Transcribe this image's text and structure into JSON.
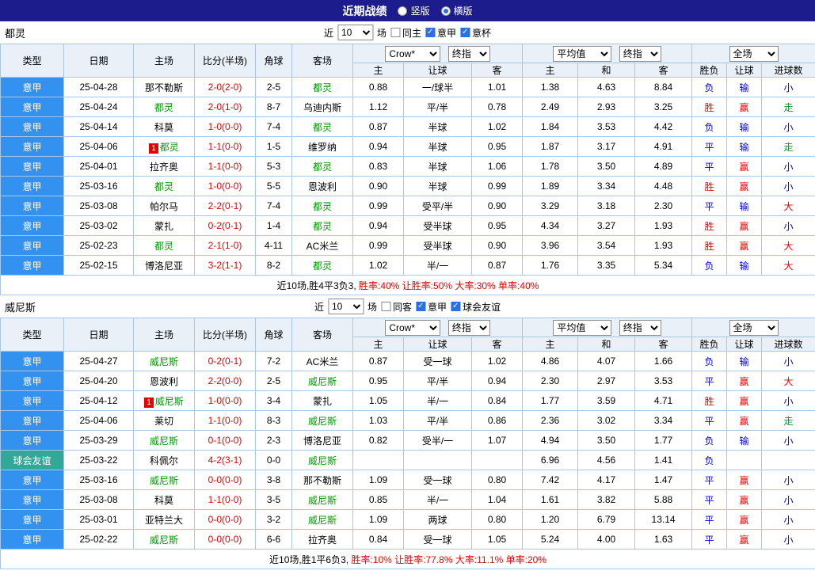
{
  "top_bar": {
    "title": "近期战绩",
    "layout_options": [
      {
        "label": "竖版",
        "selected": false
      },
      {
        "label": "横版",
        "selected": true
      }
    ]
  },
  "controls": {
    "near": "近",
    "count": "10",
    "games": "场",
    "book": "Crow*",
    "index": "终指",
    "avg": "平均值",
    "scope": "全场"
  },
  "columns": {
    "type": "类型",
    "date": "日期",
    "home": "主场",
    "score": "比分(半场)",
    "corner": "角球",
    "away": "客场",
    "odds_home": "主",
    "odds_line": "让球",
    "odds_away": "客",
    "avg_home": "主",
    "avg_draw": "和",
    "avg_away": "客",
    "res_outcome": "胜负",
    "res_handicap": "让球",
    "res_goals": "进球数"
  },
  "colors": {
    "topbar_bg": "#1c1c8c",
    "league_bg": "#3391f0",
    "friendly_bg": "#31a898",
    "focal_team": "#009900",
    "win_text": "#e60000",
    "lose_text": "#0000e0",
    "push_text": "#009933",
    "score_text": "#e60000"
  },
  "sections": [
    {
      "name": "都灵",
      "checks": [
        {
          "label": "同主",
          "on": false
        },
        {
          "label": "意甲",
          "on": true
        },
        {
          "label": "意杯",
          "on": true
        }
      ],
      "rows": [
        {
          "lg": "意甲",
          "lgc": "league",
          "date": "25-04-28",
          "badge": "",
          "home": "那不勒斯",
          "homec": "",
          "score": "2-0(2-0)",
          "corner": "2-5",
          "away": "都灵",
          "awayc": "focal",
          "o1": "0.88",
          "line": "一/球半",
          "o2": "1.01",
          "m1": "1.38",
          "m2": "4.63",
          "m3": "8.84",
          "r1": "负",
          "r1c": "blue",
          "r2": "输",
          "r2c": "blue",
          "r3": "小",
          "r3c": "blue"
        },
        {
          "lg": "意甲",
          "lgc": "league",
          "date": "25-04-24",
          "badge": "",
          "home": "都灵",
          "homec": "focal",
          "score": "2-0(1-0)",
          "corner": "8-7",
          "away": "乌迪内斯",
          "awayc": "",
          "o1": "1.12",
          "line": "平/半",
          "o2": "0.78",
          "m1": "2.49",
          "m2": "2.93",
          "m3": "3.25",
          "r1": "胜",
          "r1c": "red",
          "r2": "赢",
          "r2c": "red",
          "r3": "走",
          "r3c": "green"
        },
        {
          "lg": "意甲",
          "lgc": "league",
          "date": "25-04-14",
          "badge": "",
          "home": "科莫",
          "homec": "",
          "score": "1-0(0-0)",
          "corner": "7-4",
          "away": "都灵",
          "awayc": "focal",
          "o1": "0.87",
          "line": "半球",
          "o2": "1.02",
          "m1": "1.84",
          "m2": "3.53",
          "m3": "4.42",
          "r1": "负",
          "r1c": "blue",
          "r2": "输",
          "r2c": "blue",
          "r3": "小",
          "r3c": "blue"
        },
        {
          "lg": "意甲",
          "lgc": "league",
          "date": "25-04-06",
          "badge": "1",
          "home": "都灵",
          "homec": "focal",
          "score": "1-1(0-0)",
          "corner": "1-5",
          "away": "维罗纳",
          "awayc": "",
          "o1": "0.94",
          "line": "半球",
          "o2": "0.95",
          "m1": "1.87",
          "m2": "3.17",
          "m3": "4.91",
          "r1": "平",
          "r1c": "blue",
          "r2": "输",
          "r2c": "blue",
          "r3": "走",
          "r3c": "green"
        },
        {
          "lg": "意甲",
          "lgc": "league",
          "date": "25-04-01",
          "badge": "",
          "home": "拉齐奥",
          "homec": "",
          "score": "1-1(0-0)",
          "corner": "5-3",
          "away": "都灵",
          "awayc": "focal",
          "o1": "0.83",
          "line": "半球",
          "o2": "1.06",
          "m1": "1.78",
          "m2": "3.50",
          "m3": "4.89",
          "r1": "平",
          "r1c": "blue",
          "r2": "赢",
          "r2c": "red",
          "r3": "小",
          "r3c": "blue"
        },
        {
          "lg": "意甲",
          "lgc": "league",
          "date": "25-03-16",
          "badge": "",
          "home": "都灵",
          "homec": "focal",
          "score": "1-0(0-0)",
          "corner": "5-5",
          "away": "恩波利",
          "awayc": "",
          "o1": "0.90",
          "line": "半球",
          "o2": "0.99",
          "m1": "1.89",
          "m2": "3.34",
          "m3": "4.48",
          "r1": "胜",
          "r1c": "red",
          "r2": "赢",
          "r2c": "red",
          "r3": "小",
          "r3c": "blue"
        },
        {
          "lg": "意甲",
          "lgc": "league",
          "date": "25-03-08",
          "badge": "",
          "home": "帕尔马",
          "homec": "",
          "score": "2-2(0-1)",
          "corner": "7-4",
          "away": "都灵",
          "awayc": "focal",
          "o1": "0.99",
          "line": "受平/半",
          "o2": "0.90",
          "m1": "3.29",
          "m2": "3.18",
          "m3": "2.30",
          "r1": "平",
          "r1c": "blue",
          "r2": "输",
          "r2c": "blue",
          "r3": "大",
          "r3c": "red"
        },
        {
          "lg": "意甲",
          "lgc": "league",
          "date": "25-03-02",
          "badge": "",
          "home": "蒙扎",
          "homec": "",
          "score": "0-2(0-1)",
          "corner": "1-4",
          "away": "都灵",
          "awayc": "focal",
          "o1": "0.94",
          "line": "受半球",
          "o2": "0.95",
          "m1": "4.34",
          "m2": "3.27",
          "m3": "1.93",
          "r1": "胜",
          "r1c": "red",
          "r2": "赢",
          "r2c": "red",
          "r3": "小",
          "r3c": "blue"
        },
        {
          "lg": "意甲",
          "lgc": "league",
          "date": "25-02-23",
          "badge": "",
          "home": "都灵",
          "homec": "focal",
          "score": "2-1(1-0)",
          "corner": "4-11",
          "away": "AC米兰",
          "awayc": "",
          "o1": "0.99",
          "line": "受半球",
          "o2": "0.90",
          "m1": "3.96",
          "m2": "3.54",
          "m3": "1.93",
          "r1": "胜",
          "r1c": "red",
          "r2": "赢",
          "r2c": "red",
          "r3": "大",
          "r3c": "red"
        },
        {
          "lg": "意甲",
          "lgc": "league",
          "date": "25-02-15",
          "badge": "",
          "home": "博洛尼亚",
          "homec": "",
          "score": "3-2(1-1)",
          "corner": "8-2",
          "away": "都灵",
          "awayc": "focal",
          "o1": "1.02",
          "line": "半/一",
          "o2": "0.87",
          "m1": "1.76",
          "m2": "3.35",
          "m3": "5.34",
          "r1": "负",
          "r1c": "blue",
          "r2": "输",
          "r2c": "blue",
          "r3": "大",
          "r3c": "red"
        }
      ],
      "footer": {
        "summary": "近10场,胜4平3负3,",
        "stats": "胜率:40% 让胜率:50% 大率:30% 单率:40%"
      }
    },
    {
      "name": "威尼斯",
      "checks": [
        {
          "label": "同客",
          "on": false
        },
        {
          "label": "意甲",
          "on": true
        },
        {
          "label": "球会友谊",
          "on": true
        }
      ],
      "rows": [
        {
          "lg": "意甲",
          "lgc": "league",
          "date": "25-04-27",
          "badge": "",
          "home": "威尼斯",
          "homec": "focal",
          "score": "0-2(0-1)",
          "corner": "7-2",
          "away": "AC米兰",
          "awayc": "",
          "o1": "0.87",
          "line": "受一球",
          "o2": "1.02",
          "m1": "4.86",
          "m2": "4.07",
          "m3": "1.66",
          "r1": "负",
          "r1c": "blue",
          "r2": "输",
          "r2c": "blue",
          "r3": "小",
          "r3c": "blue"
        },
        {
          "lg": "意甲",
          "lgc": "league",
          "date": "25-04-20",
          "badge": "",
          "home": "恩波利",
          "homec": "",
          "score": "2-2(0-0)",
          "corner": "2-5",
          "away": "威尼斯",
          "awayc": "focal",
          "o1": "0.95",
          "line": "平/半",
          "o2": "0.94",
          "m1": "2.30",
          "m2": "2.97",
          "m3": "3.53",
          "r1": "平",
          "r1c": "blue",
          "r2": "赢",
          "r2c": "red",
          "r3": "大",
          "r3c": "red"
        },
        {
          "lg": "意甲",
          "lgc": "league",
          "date": "25-04-12",
          "badge": "1",
          "home": "威尼斯",
          "homec": "focal",
          "score": "1-0(0-0)",
          "corner": "3-4",
          "away": "蒙扎",
          "awayc": "",
          "o1": "1.05",
          "line": "半/一",
          "o2": "0.84",
          "m1": "1.77",
          "m2": "3.59",
          "m3": "4.71",
          "r1": "胜",
          "r1c": "red",
          "r2": "赢",
          "r2c": "red",
          "r3": "小",
          "r3c": "blue"
        },
        {
          "lg": "意甲",
          "lgc": "league",
          "date": "25-04-06",
          "badge": "",
          "home": "莱切",
          "homec": "",
          "score": "1-1(0-0)",
          "corner": "8-3",
          "away": "威尼斯",
          "awayc": "focal",
          "o1": "1.03",
          "line": "平/半",
          "o2": "0.86",
          "m1": "2.36",
          "m2": "3.02",
          "m3": "3.34",
          "r1": "平",
          "r1c": "blue",
          "r2": "赢",
          "r2c": "red",
          "r3": "走",
          "r3c": "green"
        },
        {
          "lg": "意甲",
          "lgc": "league",
          "date": "25-03-29",
          "badge": "",
          "home": "威尼斯",
          "homec": "focal",
          "score": "0-1(0-0)",
          "corner": "2-3",
          "away": "博洛尼亚",
          "awayc": "",
          "o1": "0.82",
          "line": "受半/一",
          "o2": "1.07",
          "m1": "4.94",
          "m2": "3.50",
          "m3": "1.77",
          "r1": "负",
          "r1c": "blue",
          "r2": "输",
          "r2c": "blue",
          "r3": "小",
          "r3c": "blue"
        },
        {
          "lg": "球会友谊",
          "lgc": "friendly",
          "date": "25-03-22",
          "badge": "",
          "home": "科佩尔",
          "homec": "",
          "score": "4-2(3-1)",
          "corner": "0-0",
          "away": "威尼斯",
          "awayc": "focal",
          "o1": "",
          "line": "",
          "o2": "",
          "m1": "6.96",
          "m2": "4.56",
          "m3": "1.41",
          "r1": "负",
          "r1c": "blue",
          "r2": "",
          "r2c": "",
          "r3": "",
          "r3c": ""
        },
        {
          "lg": "意甲",
          "lgc": "league",
          "date": "25-03-16",
          "badge": "",
          "home": "威尼斯",
          "homec": "focal",
          "score": "0-0(0-0)",
          "corner": "3-8",
          "away": "那不勒斯",
          "awayc": "",
          "o1": "1.09",
          "line": "受一球",
          "o2": "0.80",
          "m1": "7.42",
          "m2": "4.17",
          "m3": "1.47",
          "r1": "平",
          "r1c": "blue",
          "r2": "赢",
          "r2c": "red",
          "r3": "小",
          "r3c": "blue"
        },
        {
          "lg": "意甲",
          "lgc": "league",
          "date": "25-03-08",
          "badge": "",
          "home": "科莫",
          "homec": "",
          "score": "1-1(0-0)",
          "corner": "3-5",
          "away": "威尼斯",
          "awayc": "focal",
          "o1": "0.85",
          "line": "半/一",
          "o2": "1.04",
          "m1": "1.61",
          "m2": "3.82",
          "m3": "5.88",
          "r1": "平",
          "r1c": "blue",
          "r2": "赢",
          "r2c": "red",
          "r3": "小",
          "r3c": "blue"
        },
        {
          "lg": "意甲",
          "lgc": "league",
          "date": "25-03-01",
          "badge": "",
          "home": "亚特兰大",
          "homec": "",
          "score": "0-0(0-0)",
          "corner": "3-2",
          "away": "威尼斯",
          "awayc": "focal",
          "o1": "1.09",
          "line": "两球",
          "o2": "0.80",
          "m1": "1.20",
          "m2": "6.79",
          "m3": "13.14",
          "r1": "平",
          "r1c": "blue",
          "r2": "赢",
          "r2c": "red",
          "r3": "小",
          "r3c": "blue"
        },
        {
          "lg": "意甲",
          "lgc": "league",
          "date": "25-02-22",
          "badge": "",
          "home": "威尼斯",
          "homec": "focal",
          "score": "0-0(0-0)",
          "corner": "6-6",
          "away": "拉齐奥",
          "awayc": "",
          "o1": "0.84",
          "line": "受一球",
          "o2": "1.05",
          "m1": "5.24",
          "m2": "4.00",
          "m3": "1.63",
          "r1": "平",
          "r1c": "blue",
          "r2": "赢",
          "r2c": "red",
          "r3": "小",
          "r3c": "blue"
        }
      ],
      "footer": {
        "summary": "近10场,胜1平6负3,",
        "stats": "胜率:10% 让胜率:77.8% 大率:11.1% 单率:20%"
      }
    }
  ]
}
